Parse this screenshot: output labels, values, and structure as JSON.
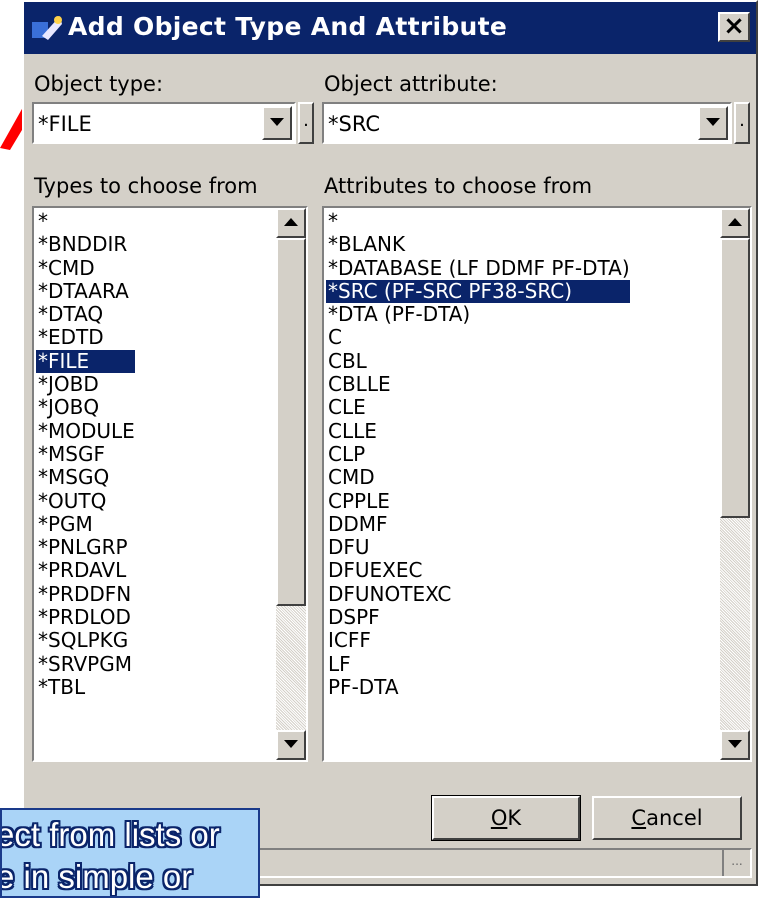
{
  "dialog": {
    "title": "Add Object Type And Attribute",
    "close_label": "×"
  },
  "object_type": {
    "label": "Object type:",
    "value": "*FILE"
  },
  "object_attribute": {
    "label": "Object attribute:",
    "value": "*SRC"
  },
  "types_list": {
    "label": "Types to choose from",
    "items": [
      "*",
      "*BNDDIR",
      "*CMD",
      "*DTAARA",
      "*DTAQ",
      "*EDTD",
      "*FILE",
      "*JOBD",
      "*JOBQ",
      "*MODULE",
      "*MSGF",
      "*MSGQ",
      "*OUTQ",
      "*PGM",
      "*PNLGRP",
      "*PRDAVL",
      "*PRDDFN",
      "*PRDLOD",
      "*SQLPKG",
      "*SRVPGM",
      "*TBL"
    ],
    "selected": "*FILE"
  },
  "attributes_list": {
    "label": "Attributes to choose from",
    "items": [
      "*",
      "*BLANK",
      "*DATABASE (LF DDMF PF-DTA)",
      "*SRC (PF-SRC PF38-SRC)",
      "*DTA (PF-DTA)",
      "C",
      "CBL",
      "CBLLE",
      "CLE",
      "CLLE",
      "CLP",
      "CMD",
      "CPPLE",
      "DDMF",
      "DFU",
      "DFUEXEC",
      "DFUNOTEXC",
      "DSPF",
      "ICFF",
      "LF",
      "PF-DTA"
    ],
    "selected": "*SRC (PF-SRC PF38-SRC)"
  },
  "buttons": {
    "ok_mnemonic": "O",
    "ok_rest": "K",
    "cancel_mnemonic": "C",
    "cancel_rest": "ancel",
    "mini_label": "."
  },
  "status_bar": {
    "grip": "..."
  },
  "callout": {
    "line1": "ect from lists or",
    "line2": "e in simple or"
  },
  "colors": {
    "titlebar": "#0a246a",
    "selection": "#0a246a",
    "dialog_face": "#d4d0c8",
    "callout_fill": "#aad4f7",
    "arrow": "#ff0000"
  }
}
